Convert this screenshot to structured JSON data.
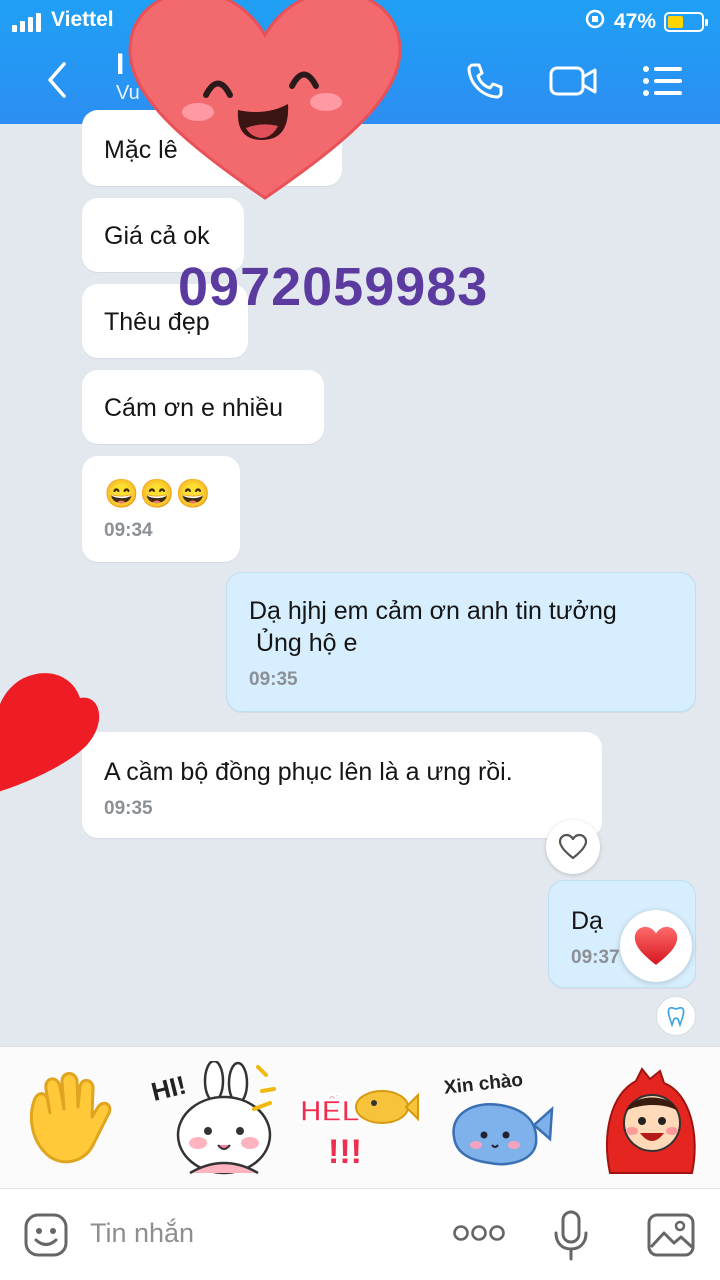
{
  "status_bar": {
    "carrier": "Viettel",
    "battery": "47%",
    "battery_level": 0.47
  },
  "header": {
    "contact_name": "I",
    "contact_subtitle": "Vu",
    "icons": [
      "back-chevron-icon",
      "phone-call-icon",
      "video-call-icon",
      "menu-list-icon"
    ]
  },
  "overlay": {
    "phone_number": "0972059983"
  },
  "messages": [
    {
      "dir": "in",
      "text": "Mặc lê"
    },
    {
      "dir": "in",
      "text": "Giá cả ok"
    },
    {
      "dir": "in",
      "text": "Thêu đẹp"
    },
    {
      "dir": "in",
      "text": "Cám ơn e nhiều"
    },
    {
      "dir": "in",
      "text": "😄😄😄",
      "time": "09:34"
    },
    {
      "dir": "out",
      "text_lines": [
        "Dạ hjhj em cảm ơn anh tin tưởng",
        " Ủng hộ e"
      ],
      "time": "09:35"
    },
    {
      "dir": "in",
      "text": "A cầm bộ đồng phục lên là a ưng rồi.",
      "time": "09:35"
    },
    {
      "dir": "out",
      "text": "Dạ",
      "time": "09:37"
    }
  ],
  "stickers": [
    {
      "name": "waving-hand-sticker"
    },
    {
      "name": "bunny-hi-sticker",
      "text": "HI!"
    },
    {
      "name": "hello-fish-sticker",
      "text": "HẾL"
    },
    {
      "name": "xin-chao-whale-sticker",
      "text": "Xin chào"
    },
    {
      "name": "red-costume-kid-sticker"
    }
  ],
  "input": {
    "placeholder": "Tin nhắn"
  },
  "colors": {
    "header": "#2c8ef2",
    "outgoing_bubble": "#d6eefd",
    "phone_overlay": "#5b3b9f",
    "heart": "#f0646b"
  }
}
